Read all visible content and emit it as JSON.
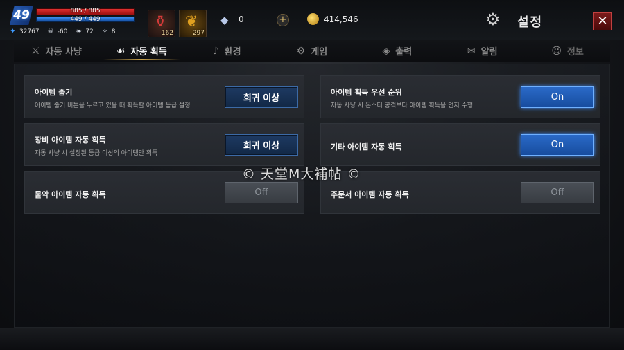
{
  "hud": {
    "level": "49",
    "hp": "885 / 885",
    "mp": "449 / 449",
    "stats": [
      {
        "icon": "blue-flame-icon",
        "value": "32767"
      },
      {
        "icon": "skull-icon",
        "value": "-60"
      },
      {
        "icon": "wing-icon",
        "value": "72"
      },
      {
        "icon": "claw-icon",
        "value": "8"
      }
    ],
    "slots": [
      {
        "icon": "red-potion-icon",
        "count": "162"
      },
      {
        "icon": "gold-leaf-icon",
        "count": "297"
      }
    ],
    "diamond": "0",
    "plus": "+",
    "gold": "414,546"
  },
  "header": {
    "title": "설정",
    "close": "✕"
  },
  "tabs": [
    {
      "label": "자동 사냥",
      "icon": "sword-icon"
    },
    {
      "label": "자동 획득",
      "icon": "pickup-icon",
      "active": true
    },
    {
      "label": "환경",
      "icon": "music-note-icon"
    },
    {
      "label": "게임",
      "icon": "gear-icon"
    },
    {
      "label": "출력",
      "icon": "cube-icon"
    },
    {
      "label": "알림",
      "icon": "megaphone-icon"
    },
    {
      "label": "정보",
      "icon": "person-icon"
    }
  ],
  "settings": {
    "left": [
      {
        "title": "아이템 줍기",
        "desc": "아이템 줍기 버튼을 누르고 있을 때 획득할 아이템 등급 설정",
        "button": "희귀 이상"
      },
      {
        "title": "장비 아이템 자동 획득",
        "desc": "자동 사냥 시 설정된 등급 이상의 아이템만 획득",
        "button": "희귀 이상"
      },
      {
        "title": "물약 아이템 자동 획득",
        "desc": "",
        "button": "Off"
      }
    ],
    "right": [
      {
        "title": "아이템 획득 우선 순위",
        "desc": "자동 사냥 시 몬스터 공격보다 아이템 획득을 먼저 수행",
        "button": "On"
      },
      {
        "title": "기타 아이템 자동 획득",
        "desc": "",
        "button": "On"
      },
      {
        "title": "주문서 아이템 자동 획득",
        "desc": "",
        "button": "Off"
      }
    ]
  },
  "watermark": "© 天堂M大補帖 ©"
}
